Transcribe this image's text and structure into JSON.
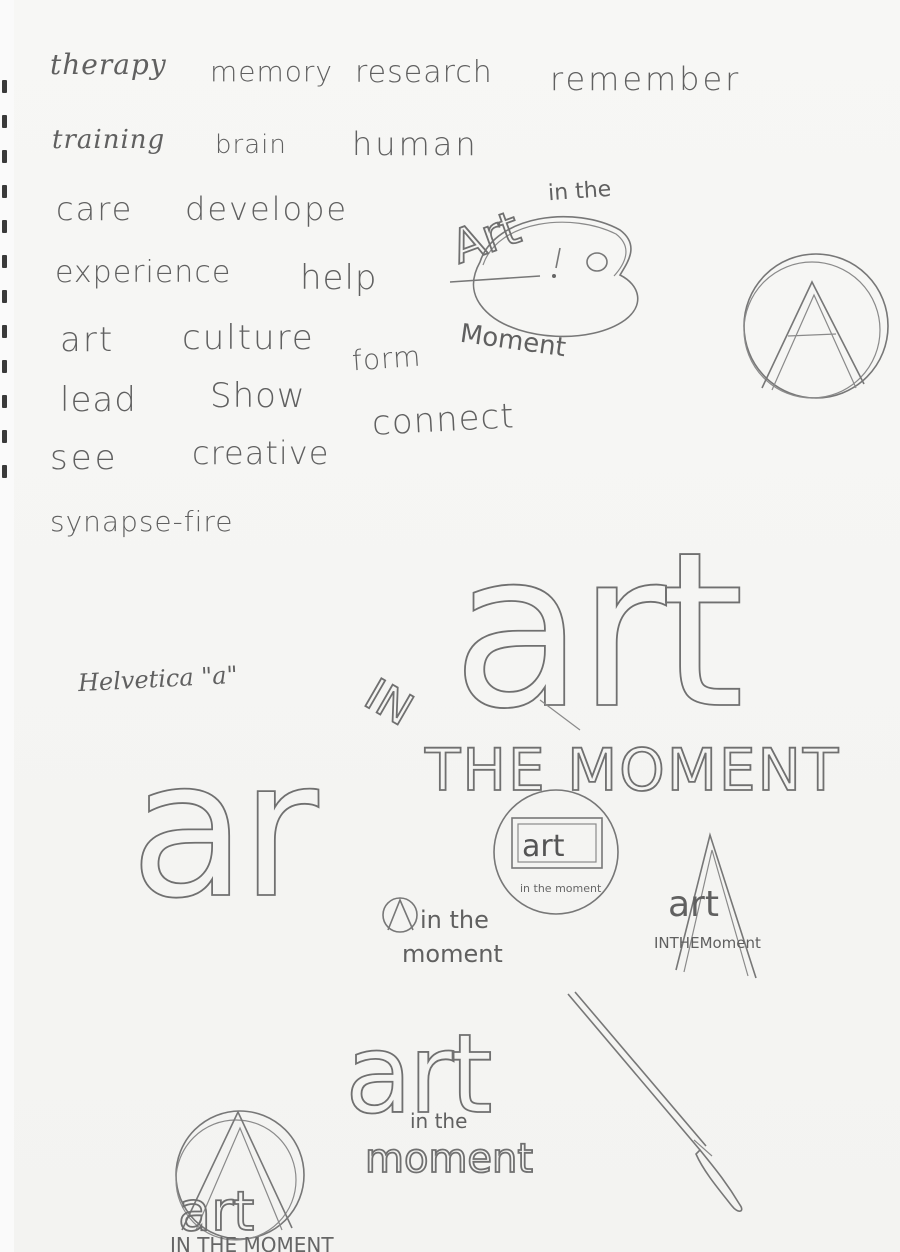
{
  "words": [
    "therapy",
    "memory",
    "research",
    "remember",
    "training",
    "brain",
    "human",
    "care",
    "develope",
    "experience",
    "help",
    "art",
    "culture",
    "lead",
    "Show",
    "see",
    "creative",
    "synapse-fire",
    "form",
    "connect"
  ],
  "font_note": "Helvetica \"a\"",
  "logos": {
    "palette_top": "Art",
    "palette_in_the": "in the",
    "palette_moment": "Moment",
    "big_art_1": "art",
    "big_art_2": "ar",
    "in_the_moment_big": "THE MOMENT",
    "in_small": "IN",
    "frame_art": "art",
    "frame_caption": "in the moment",
    "circle_a_in_the": "in the",
    "circle_a_moment": "moment",
    "compass_art": "art",
    "compass_caption": "INTHEMoment",
    "stacked_art": "art",
    "stacked_in_the": "in the",
    "stacked_moment": "moment",
    "bottom_art": "art",
    "bottom_caption": "IN THE MOMENT"
  },
  "colors": {
    "pencil": "#606060",
    "paper": "#f6f6f4",
    "binding": "#3a3a3a"
  }
}
